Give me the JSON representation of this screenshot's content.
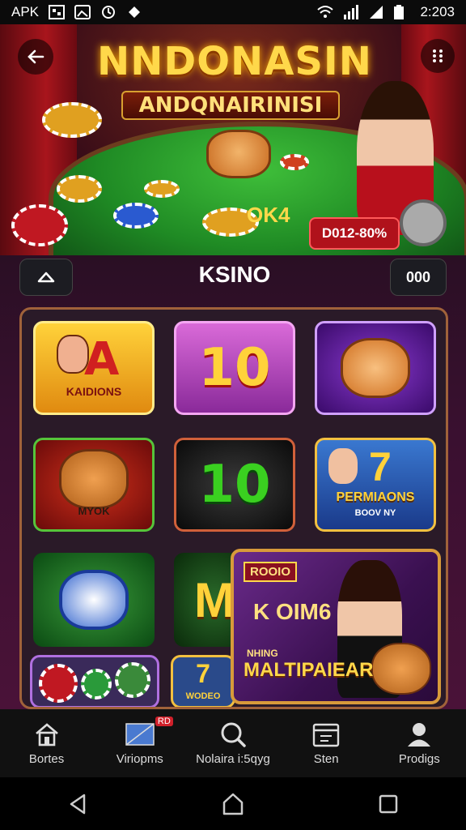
{
  "status_bar": {
    "carrier": "APK",
    "time": "2:203"
  },
  "hero": {
    "title": "NNDONASIN",
    "subtitle": "ANDQNAIRINISI",
    "table_text": "OK4",
    "badge": "D012-80%"
  },
  "section": {
    "title": "KSINO",
    "right_button": "000"
  },
  "tiles": [
    {
      "label": "KAIDIONS"
    },
    {
      "label": "10"
    },
    {
      "label": ""
    },
    {
      "label": "MYOK"
    },
    {
      "label": "10"
    },
    {
      "label": "PERMIAONS",
      "sub": "BOOV NY",
      "num": "7"
    },
    {
      "label": ""
    },
    {
      "label": "M"
    },
    {
      "label": ""
    },
    {
      "label": "7",
      "sub": "WODEO"
    }
  ],
  "promo": {
    "tag": "ROOIO",
    "main": "K OIM6",
    "small": "NHING",
    "big": "MALTIPAIEAR"
  },
  "bottom_nav": [
    {
      "label": "Bortes",
      "icon": "home-icon"
    },
    {
      "label": "Viriopms",
      "icon": "video-icon",
      "badge": "RD"
    },
    {
      "label": "Nolaira i:5qyg",
      "icon": "search-icon"
    },
    {
      "label": "Sten",
      "icon": "calendar-icon"
    },
    {
      "label": "Prodigs",
      "icon": "profile-icon"
    }
  ],
  "colors": {
    "gold": "#ffd84a",
    "accent_red": "#b0121b",
    "panel": "#2a0f24"
  }
}
